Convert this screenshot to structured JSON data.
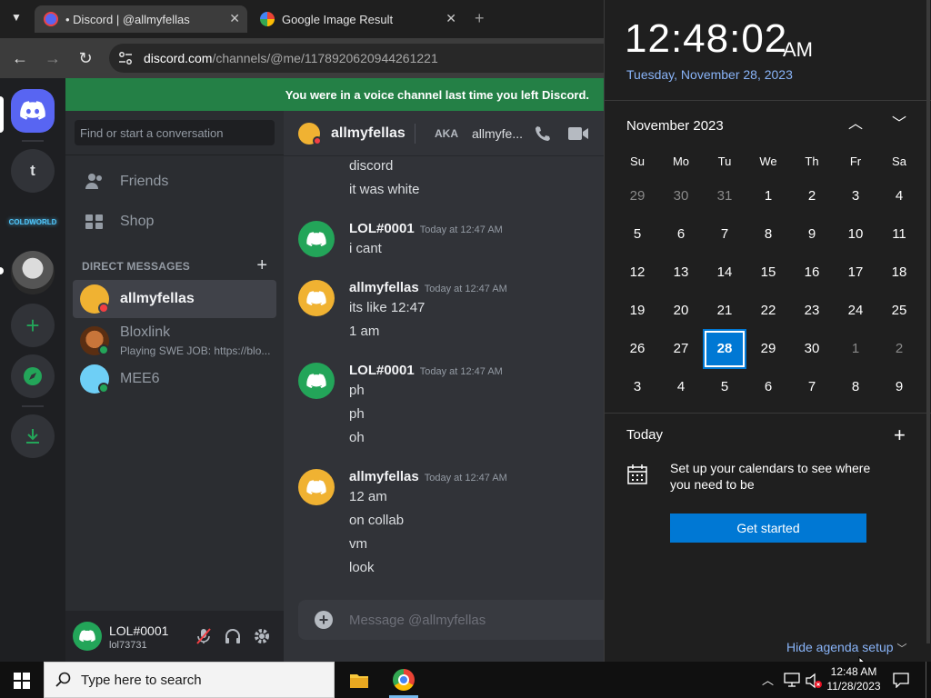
{
  "browser": {
    "tabs": [
      {
        "title": "• Discord | @allmyfellas"
      },
      {
        "title": "Google Image Result"
      }
    ],
    "url_host": "discord.com",
    "url_path": "/channels/@me/1178920620944261221"
  },
  "discord": {
    "banner": "You were in a voice channel last time you left Discord.",
    "search_placeholder": "Find or start a conversation",
    "nav": {
      "friends": "Friends",
      "shop": "Shop"
    },
    "dm_header": "DIRECT MESSAGES",
    "guild_letter": "t",
    "guild_coldworld": "COLDWORLD",
    "dms": [
      {
        "name": "allmyfellas",
        "sub": ""
      },
      {
        "name": "Bloxlink",
        "sub": "Playing SWE JOB: https://blo..."
      },
      {
        "name": "MEE6",
        "sub": ""
      }
    ],
    "user": {
      "name": "LOL#0001",
      "tag": "lol73731"
    },
    "chat": {
      "title": "allmyfellas",
      "aka_label": "AKA",
      "aka_value": "allmyfe...",
      "composer_placeholder": "Message @allmyfellas",
      "loose_lines": [
        "discord",
        "it was white"
      ],
      "messages": [
        {
          "author": "LOL#0001",
          "time": "Today at 12:47 AM",
          "lines": [
            "i cant"
          ]
        },
        {
          "author": "allmyfellas",
          "time": "Today at 12:47 AM",
          "lines": [
            "its like 12:47",
            "1 am"
          ]
        },
        {
          "author": "LOL#0001",
          "time": "Today at 12:47 AM",
          "lines": [
            "ph",
            "ph",
            "oh"
          ]
        },
        {
          "author": "allmyfellas",
          "time": "Today at 12:47 AM",
          "lines": [
            "12 am",
            "on collab",
            "vm",
            "look"
          ]
        }
      ]
    }
  },
  "calendar": {
    "time": "12:48:02",
    "ampm": "AM",
    "date_long": "Tuesday, November 28, 2023",
    "month_label": "November 2023",
    "weekdays": [
      "Su",
      "Mo",
      "Tu",
      "We",
      "Th",
      "Fr",
      "Sa"
    ],
    "weeks": [
      [
        "29",
        "30",
        "31",
        "1",
        "2",
        "3",
        "4"
      ],
      [
        "5",
        "6",
        "7",
        "8",
        "9",
        "10",
        "11"
      ],
      [
        "12",
        "13",
        "14",
        "15",
        "16",
        "17",
        "18"
      ],
      [
        "19",
        "20",
        "21",
        "22",
        "23",
        "24",
        "25"
      ],
      [
        "26",
        "27",
        "28",
        "29",
        "30",
        "1",
        "2"
      ],
      [
        "3",
        "4",
        "5",
        "6",
        "7",
        "8",
        "9"
      ]
    ],
    "today_day": "28",
    "agenda_title": "Today",
    "setup_message": "Set up your calendars to see where you need to be",
    "get_started": "Get started",
    "hide_agenda": "Hide agenda setup"
  },
  "taskbar": {
    "search_placeholder": "Type here to search",
    "time": "12:48 AM",
    "date": "11/28/2023"
  },
  "colors": {
    "discord_blurple": "#5865f2",
    "discord_green": "#248046",
    "win_accent": "#0078d4"
  }
}
